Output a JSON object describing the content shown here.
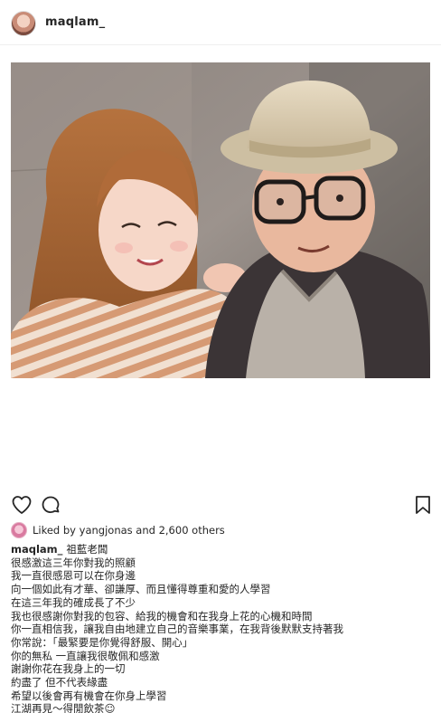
{
  "header": {
    "username": "maqlam_",
    "avatar_icon": "user-avatar",
    "more_icon": "more-options-icon"
  },
  "photo": {
    "description_icon": "selfie-photo"
  },
  "actions": {
    "like_icon": "heart-icon",
    "comment_icon": "comment-icon",
    "share_icon": "share-icon",
    "save_icon": "bookmark-icon"
  },
  "likes": {
    "text": "Liked by yangjonas and 2,600 others"
  },
  "caption": {
    "username": "maqlam_",
    "first_line": "祖藍老闆",
    "lines": [
      "很感激這三年你對我的照顧",
      "我一直很感恩可以在你身邊",
      "向一個如此有才華、卻謙厚、而且懂得尊重和愛的人學習",
      "在這三年我的確成長了不少",
      "我也很感謝你對我的包容、給我的機會和在我身上花的心機和時間",
      "你一直相信我，讓我自由地建立自己的音樂事業，在我背後默默支持著我",
      "你常說：「最緊要是你覺得舒服、開心」",
      "你的無私 一直讓我很敬佩和感激",
      "謝謝你花在我身上的一切",
      "約盡了 但不代表緣盡",
      "希望以後會再有機會在你身上學習",
      "江湖再見～得閒飲茶☺"
    ]
  },
  "colors": {
    "text": "#262626",
    "border": "#efefef"
  }
}
